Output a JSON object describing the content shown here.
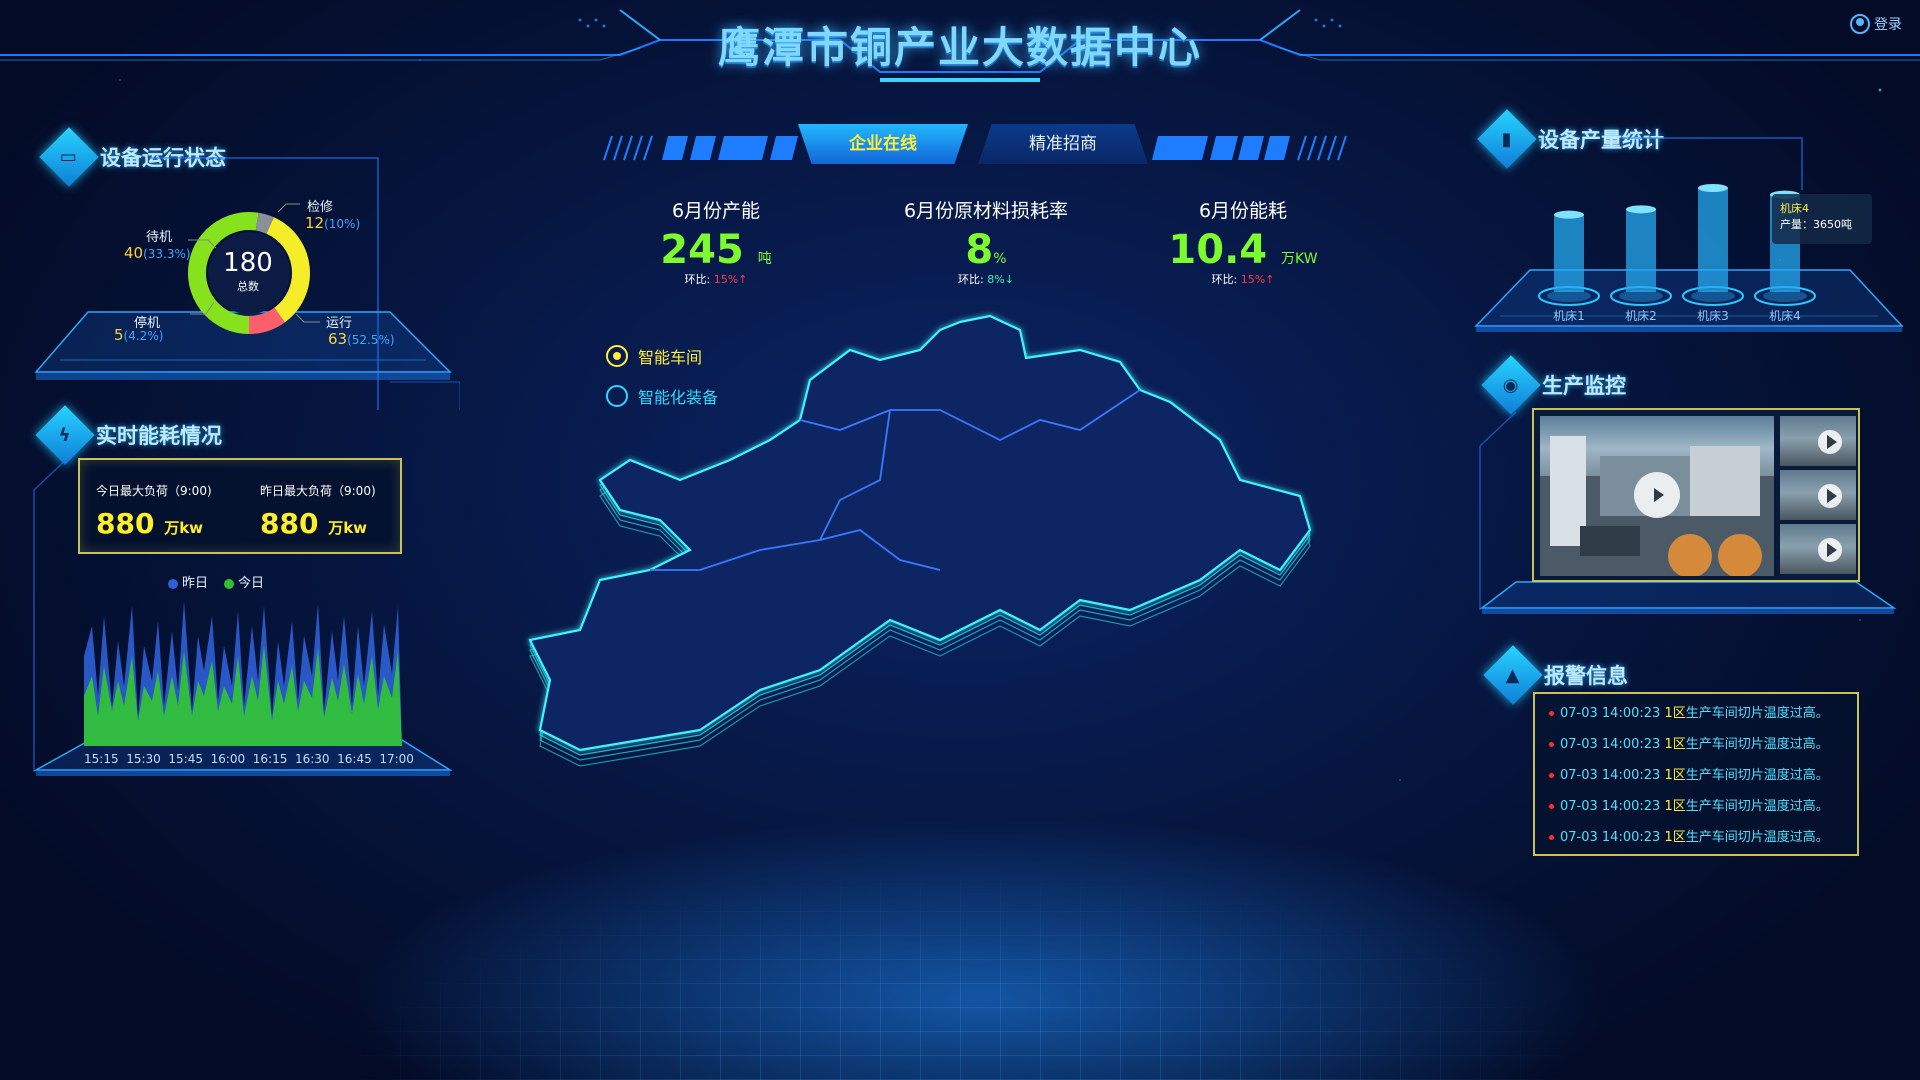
{
  "header": {
    "title": "鹰潭市铜产业大数据中心",
    "login_label": "登录"
  },
  "device_status": {
    "title": "设备运行状态",
    "total": "180",
    "total_label": "总数",
    "segments": [
      {
        "name": "运行",
        "count": "63",
        "pct": "(52.5%)",
        "color": "#86e21c"
      },
      {
        "name": "待机",
        "count": "40",
        "pct": "(33.3%)",
        "color": "#f5ec2a"
      },
      {
        "name": "检修",
        "count": "12",
        "pct": "(10%)",
        "color": "#ff5f6d"
      },
      {
        "name": "停机",
        "count": "5",
        "pct": "(4.2%)",
        "color": "#8a8f9a"
      }
    ]
  },
  "energy": {
    "title": "实时能耗情况",
    "today_caption": "今日最大负荷（9:00)",
    "today_value": "880",
    "today_unit": "万kw",
    "yesterday_caption": "昨日最大负荷（9:00)",
    "yesterday_value": "880",
    "yesterday_unit": "万kw",
    "legend": [
      {
        "name": "昨日",
        "color": "#2f5fd8"
      },
      {
        "name": "今日",
        "color": "#2fc22f"
      }
    ],
    "x_ticks": [
      "15:15",
      "15:30",
      "15:45",
      "16:00",
      "16:15",
      "16:30",
      "16:45",
      "17:00"
    ]
  },
  "tabs": {
    "active": "企业在线",
    "inactive": "精准招商"
  },
  "stats": [
    {
      "caption": "6月份产能",
      "value": "245",
      "unit": "吨",
      "cmp_label": "环比:",
      "cmp_value": "15%",
      "trend": "up",
      "arrow": "↑"
    },
    {
      "caption": "6月份原材料损耗率",
      "value": "8",
      "unit": "%",
      "cmp_label": "环比:",
      "cmp_value": "8%",
      "trend": "down",
      "arrow": "↓"
    },
    {
      "caption": "6月份能耗",
      "value": "10.4",
      "unit": "万KW",
      "cmp_label": "环比:",
      "cmp_value": "15%",
      "trend": "up",
      "arrow": "↑"
    }
  ],
  "map_legend": {
    "item1": "智能车间",
    "item2": "智能化装备"
  },
  "output": {
    "title": "设备产量统计",
    "tooltip_name": "机床4",
    "tooltip_label": "产量：",
    "tooltip_value": "3650吨"
  },
  "chart_data": {
    "type": "bar",
    "categories": [
      "机床1",
      "机床2",
      "机床3",
      "机床4"
    ],
    "values": [
      2900,
      3100,
      3900,
      3650
    ],
    "ylim": [
      0,
      4200
    ],
    "grid": false
  },
  "monitor": {
    "title": "生产监控"
  },
  "alerts": {
    "title": "报警信息",
    "items": [
      {
        "time": "07-03 14:00:23",
        "zone": "1区",
        "text": "生产车间切片温度过高。"
      },
      {
        "time": "07-03 14:00:23",
        "zone": "1区",
        "text": "生产车间切片温度过高。"
      },
      {
        "time": "07-03 14:00:23",
        "zone": "1区",
        "text": "生产车间切片温度过高。"
      },
      {
        "time": "07-03 14:00:23",
        "zone": "1区",
        "text": "生产车间切片温度过高。"
      },
      {
        "time": "07-03 14:00:23",
        "zone": "1区",
        "text": "生产车间切片温度过高。"
      }
    ]
  }
}
